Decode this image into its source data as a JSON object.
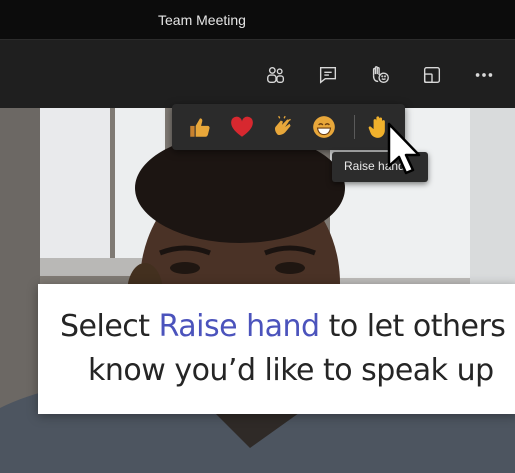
{
  "window": {
    "title": "Team Meeting"
  },
  "toolbar": {
    "buttons": [
      {
        "name": "participants-button",
        "icon": "people-icon"
      },
      {
        "name": "chat-button",
        "icon": "chat-icon"
      },
      {
        "name": "reactions-button",
        "icon": "raise-hand-smile-icon"
      },
      {
        "name": "rooms-button",
        "icon": "rooms-icon"
      },
      {
        "name": "more-actions-button",
        "icon": "more-icon"
      }
    ]
  },
  "reactions": {
    "items": [
      {
        "name": "like",
        "icon": "thumbs-up-icon"
      },
      {
        "name": "heart",
        "icon": "heart-icon"
      },
      {
        "name": "applause",
        "icon": "clapping-hands-icon"
      },
      {
        "name": "laugh",
        "icon": "laughing-face-icon"
      },
      {
        "name": "raise-hand",
        "icon": "raised-hand-icon"
      }
    ],
    "tooltip": "Raise hand"
  },
  "caption": {
    "line1_before": "Select ",
    "line1_highlight": "Raise hand",
    "line1_after": " to let others",
    "line2": "know you’d like to speak up"
  },
  "colors": {
    "highlight": "#4b53bc",
    "heart": "#d7282f",
    "emoji_yellow": "#e8a73a"
  }
}
